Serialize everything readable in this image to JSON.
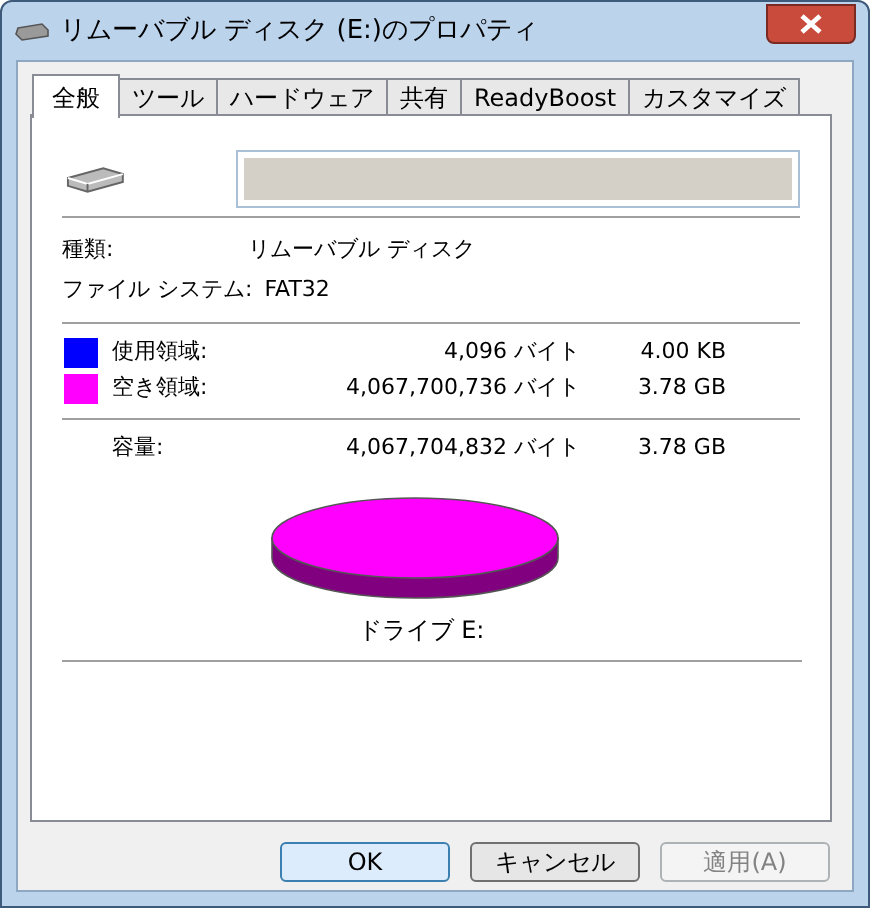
{
  "window": {
    "title": "リムーバブル ディスク (E:)のプロパティ"
  },
  "tabs": [
    {
      "label": "全般",
      "selected": true
    },
    {
      "label": "ツール",
      "selected": false
    },
    {
      "label": "ハードウェア",
      "selected": false
    },
    {
      "label": "共有",
      "selected": false
    },
    {
      "label": "ReadyBoost",
      "selected": false
    },
    {
      "label": "カスタマイズ",
      "selected": false
    }
  ],
  "properties": [
    {
      "label": "種類:",
      "value": "リムーバブル ディスク"
    },
    {
      "label": "ファイル システム:",
      "value": "FAT32"
    }
  ],
  "space": [
    {
      "label": "使用領域:",
      "bytes": "4,096 バイト",
      "size": "4.00 KB",
      "color": "#0000ff"
    },
    {
      "label": "空き領域:",
      "bytes": "4,067,700,736 バイト",
      "size": "3.78 GB",
      "color": "#ff00ff"
    }
  ],
  "capacity": {
    "label": "容量:",
    "bytes": "4,067,704,832 バイト",
    "size": "3.78 GB"
  },
  "drive_label": "ドライブ E:",
  "buttons": [
    {
      "label": "OK",
      "kind": "default",
      "disabled": false
    },
    {
      "label": "キャンセル",
      "kind": "normal",
      "disabled": false
    },
    {
      "label": "適用(A)",
      "kind": "normal",
      "disabled": true
    }
  ]
}
